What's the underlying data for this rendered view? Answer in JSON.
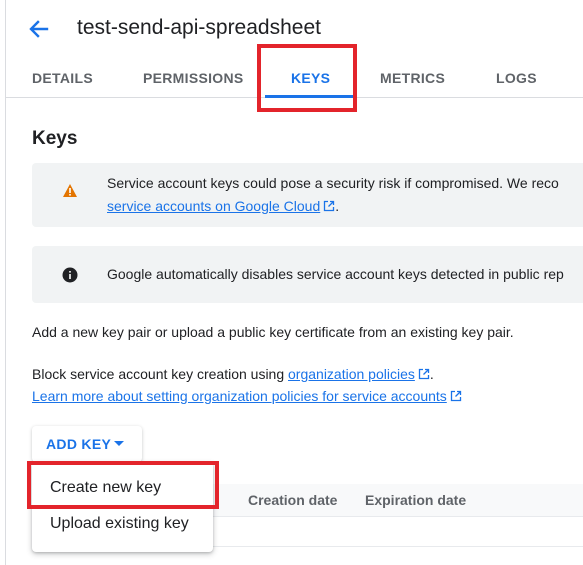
{
  "header": {
    "back_icon": "arrow-back-icon",
    "title": "test-send-api-spreadsheet"
  },
  "tabs": [
    {
      "label": "DETAILS",
      "active": false
    },
    {
      "label": "PERMISSIONS",
      "active": false
    },
    {
      "label": "KEYS",
      "active": true
    },
    {
      "label": "METRICS",
      "active": false
    },
    {
      "label": "LOGS",
      "active": false
    }
  ],
  "section": {
    "title": "Keys"
  },
  "warning_notice": {
    "icon": "warning-icon",
    "text_line1": "Service account keys could pose a security risk if compromised. We reco",
    "link_text": "service accounts on Google Cloud",
    "trailing": "."
  },
  "info_notice": {
    "icon": "info-icon",
    "text": "Google automatically disables service account keys detected in public rep"
  },
  "body": {
    "add_key_pair_text": "Add a new key pair or upload a public key certificate from an existing key pair.",
    "block_text_prefix": "Block service account key creation using ",
    "org_policies_link": "organization policies",
    "block_text_suffix": ".",
    "learn_more_link": "Learn more about setting organization policies for service accounts"
  },
  "add_key_button": {
    "label": "ADD KEY",
    "icon": "caret-down-icon"
  },
  "dropdown_menu": {
    "items": [
      {
        "label": "Create new key"
      },
      {
        "label": "Upload existing key"
      }
    ]
  },
  "table": {
    "columns": [
      "Creation date",
      "Expiration date"
    ]
  },
  "colors": {
    "accent": "#1a73e8",
    "highlight": "#e3242b",
    "warning": "#e37400"
  }
}
